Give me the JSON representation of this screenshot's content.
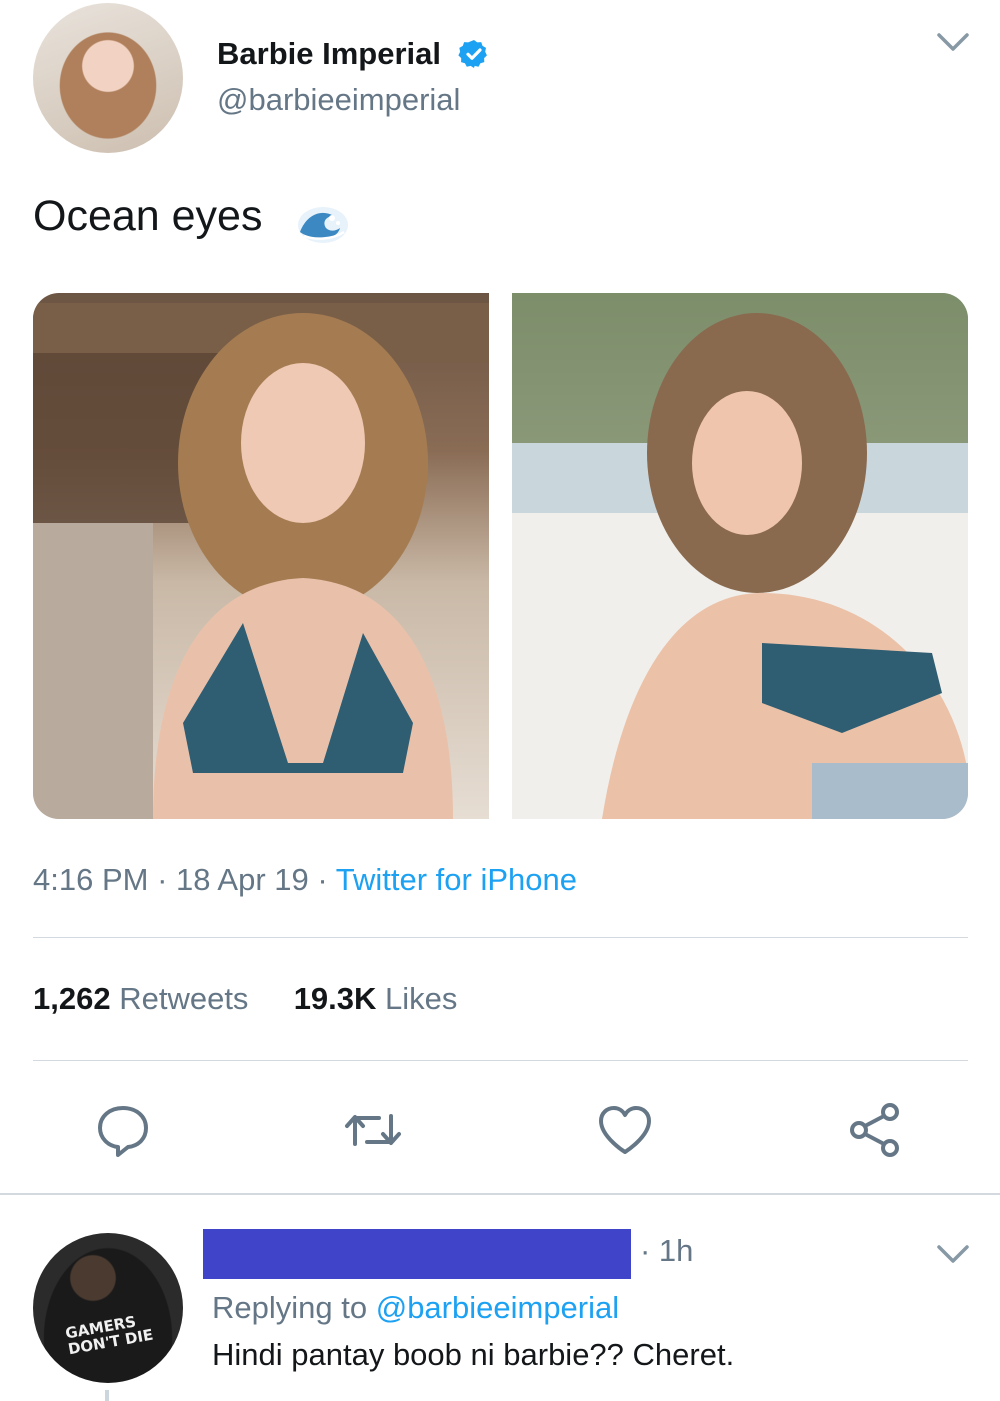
{
  "tweet": {
    "author": {
      "display_name": "Barbie Imperial",
      "handle": "@barbieeimperial",
      "verified": true,
      "avatar_icon": "profile-photo"
    },
    "text": "Ocean eyes",
    "emoji_icon": "water-wave-icon",
    "media": [
      {
        "icon": "photo-woman-beach-hut"
      },
      {
        "icon": "photo-woman-beach-shore"
      }
    ],
    "time": "4:16 PM",
    "date": "18 Apr 19",
    "separator": "·",
    "source": "Twitter for iPhone",
    "stats": {
      "retweets_count": "1,262",
      "retweets_label": "Retweets",
      "likes_count": "19.3K",
      "likes_label": "Likes"
    },
    "actions": [
      {
        "name": "reply",
        "icon": "comment-icon"
      },
      {
        "name": "retweet",
        "icon": "retweet-icon"
      },
      {
        "name": "like",
        "icon": "heart-icon"
      },
      {
        "name": "share",
        "icon": "share-icon"
      }
    ]
  },
  "reply": {
    "avatar_text": "GAMERS DON'T DIE",
    "time": "· 1h",
    "replying_prefix": "Replying to",
    "replying_handle": "@barbieeimperial",
    "text": "Hindi pantay boob ni barbie?? Cheret."
  },
  "colors": {
    "accent": "#1da1f2",
    "secondary_text": "#657786",
    "primary_text": "#14171a",
    "divider": "#d3d9de",
    "redaction": "#3f44c8"
  }
}
